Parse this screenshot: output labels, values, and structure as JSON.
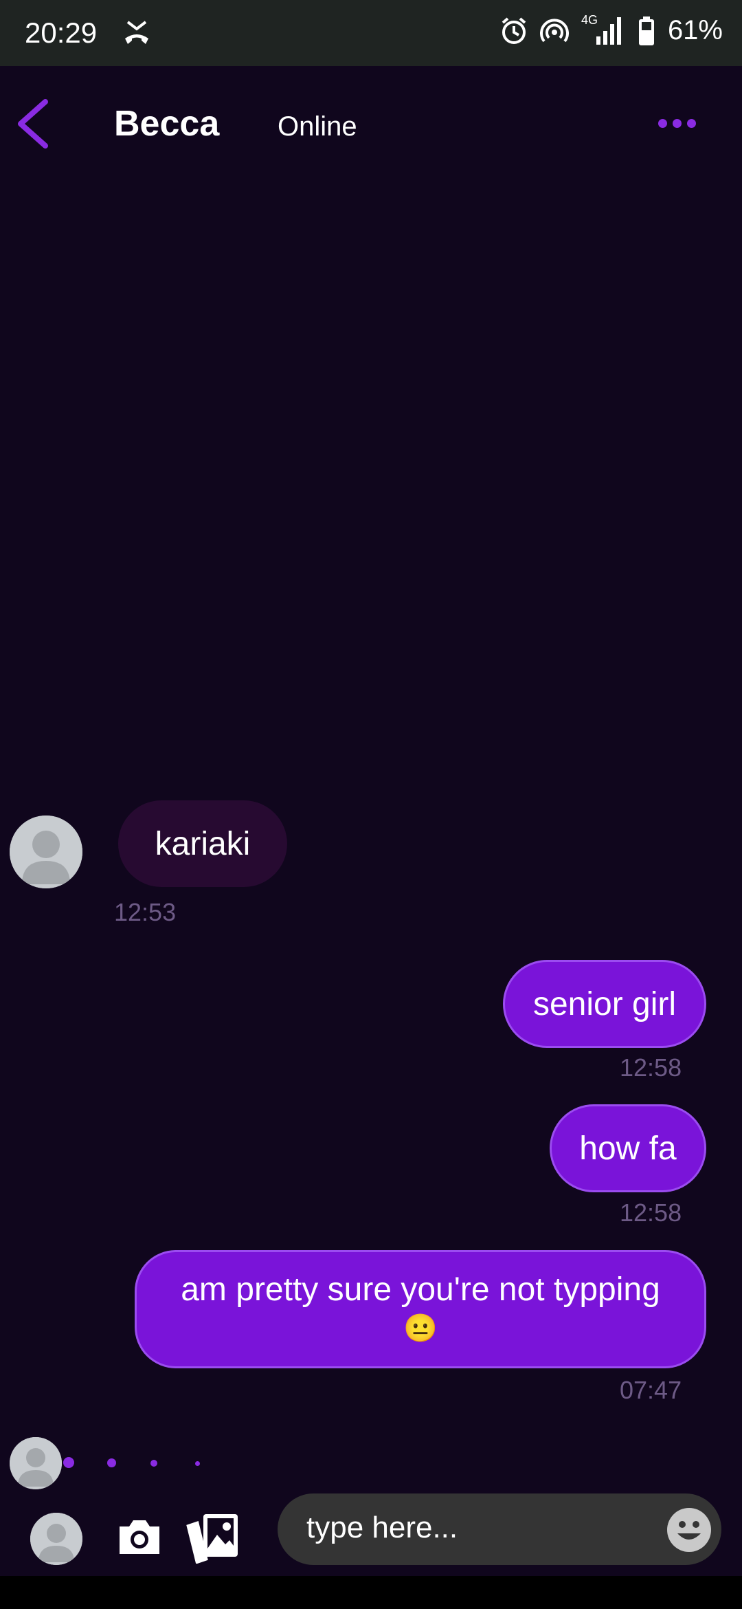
{
  "status_bar": {
    "time": "20:29",
    "battery_text": "61%",
    "network_label": "4G"
  },
  "header": {
    "contact_name": "Becca",
    "presence": "Online"
  },
  "messages": [
    {
      "direction": "incoming",
      "text": "kariaki",
      "time": "12:53"
    },
    {
      "direction": "outgoing",
      "text": "senior girl",
      "time": "12:58"
    },
    {
      "direction": "outgoing",
      "text": "how fa",
      "time": "12:58"
    },
    {
      "direction": "outgoing",
      "text": "am pretty sure you're not typping",
      "emoji": "😐",
      "time": "07:47"
    }
  ],
  "composer": {
    "placeholder": "type here..."
  },
  "colors": {
    "background": "#10061d",
    "accent": "#8a2be2",
    "outgoing_bubble": "#7a14d9",
    "incoming_bubble": "#270a31",
    "timestamp": "#6d5a86"
  },
  "icons": [
    "back-icon",
    "more-icon",
    "camera-icon",
    "gallery-icon",
    "emoji-icon",
    "alarm-icon",
    "hotspot-icon",
    "signal-icon",
    "battery-icon",
    "missed-call-icon"
  ]
}
